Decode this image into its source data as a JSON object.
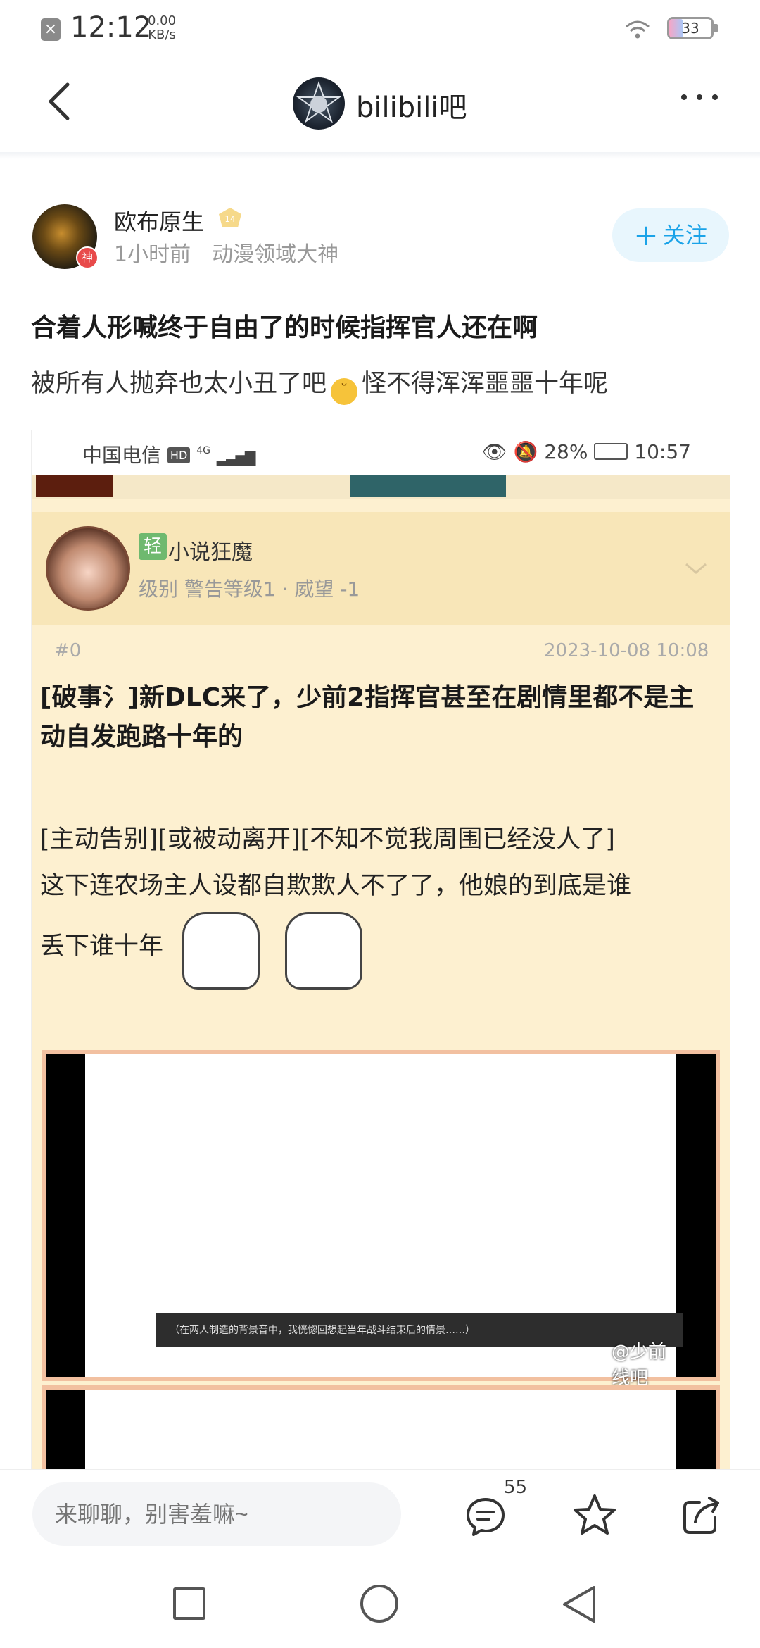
{
  "status_bar": {
    "time": "12:12",
    "net_speed_value": "0.00",
    "net_speed_unit": "KB/s",
    "battery": "33",
    "battery_fill": 0.33
  },
  "header": {
    "forum_name": "bilibili吧"
  },
  "author": {
    "name": "欧布原生",
    "level": "14",
    "avatar_badge": "神",
    "time_ago": "1小时前",
    "title": "动漫领域大神",
    "follow_label": "关注"
  },
  "post": {
    "title": "合着人形喊终于自由了的时候指挥官人还在啊",
    "body_before_emoji": "被所有人抛弃也太小丑了吧",
    "body_after_emoji": "怪不得浑浑噩噩十年呢"
  },
  "embedded_screenshot": {
    "carrier": "中国电信",
    "network_badge": "HD",
    "signal": "4G",
    "battery": "28%",
    "time": "10:57",
    "light_badge": "轻",
    "user_name": "小说狂魔",
    "user_level": "级别 警告等级1 · 威望 -1",
    "floor": "#0",
    "post_date": "2023-10-08 10:08",
    "post_title": "[破事氵]新DLC来了，少前2指挥官甚至在剧情里都不是主动自发跑路十年的",
    "line1": "[主动告别][或被动离开][不知不觉我周围已经没人了]",
    "line2": "这下连农场主人设都自欺欺人不了了，他娘的到底是谁",
    "line3": "丢下谁十年",
    "image_caption": "（在两人制造的背景音中，我恍惚回想起当年战斗结束后的情景……）",
    "watermark": "@少前线吧"
  },
  "bottom_bar": {
    "comment_placeholder": "来聊聊，别害羞嘛~",
    "comment_count": "55"
  },
  "colors": {
    "accent": "#1aa3e8",
    "follow_bg": "#e8f6fd",
    "embedded_bg": "#fdf0d0"
  }
}
